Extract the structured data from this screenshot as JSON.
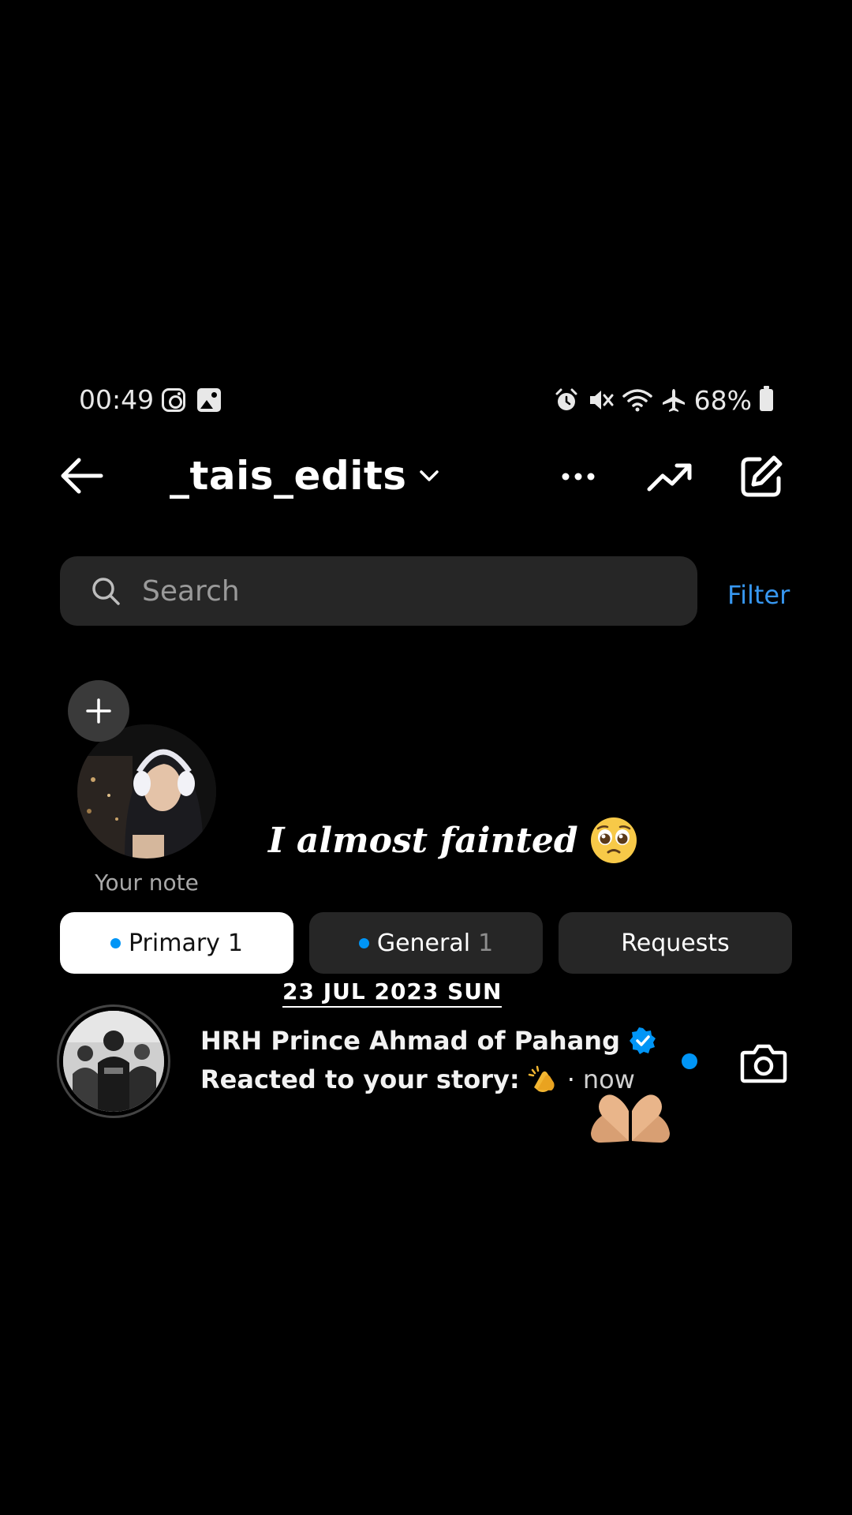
{
  "status_bar": {
    "time": "00:49",
    "battery": "68%",
    "icons": [
      "instagram-icon",
      "gallery-icon",
      "alarm-icon",
      "mute-icon",
      "wifi-icon",
      "airplane-icon",
      "battery-icon"
    ]
  },
  "header": {
    "username": "_tais_edits",
    "icons": [
      "back-arrow-icon",
      "chevron-down-icon",
      "more-icon",
      "trending-icon",
      "compose-icon"
    ]
  },
  "search": {
    "placeholder": "Search",
    "filter_label": "Filter"
  },
  "note": {
    "label": "Your note"
  },
  "overlay": {
    "caption": "I almost fainted",
    "caption_emoji": "🥹",
    "date_stamp": "23 JUL 2023 SUN"
  },
  "tabs": [
    {
      "label": "Primary",
      "count": "1",
      "active": true
    },
    {
      "label": "General",
      "count": "1",
      "active": false
    },
    {
      "label": "Requests",
      "count": "",
      "active": false
    }
  ],
  "conversations": [
    {
      "name": "HRH Prince Ahmad of Pahang",
      "verified": true,
      "message": "Reacted to your story:",
      "emoji": "👏",
      "separator": "·",
      "time": "now",
      "unread": true
    }
  ],
  "colors": {
    "background": "#000000",
    "accent": "#0095f6",
    "filter": "#3797f0",
    "surface": "#262626"
  }
}
